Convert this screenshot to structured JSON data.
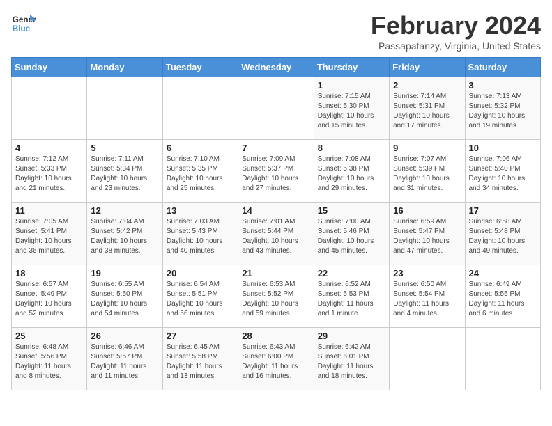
{
  "header": {
    "logo_line1": "General",
    "logo_line2": "Blue",
    "title": "February 2024",
    "subtitle": "Passapatanzy, Virginia, United States"
  },
  "weekdays": [
    "Sunday",
    "Monday",
    "Tuesday",
    "Wednesday",
    "Thursday",
    "Friday",
    "Saturday"
  ],
  "weeks": [
    [
      {
        "day": "",
        "info": ""
      },
      {
        "day": "",
        "info": ""
      },
      {
        "day": "",
        "info": ""
      },
      {
        "day": "",
        "info": ""
      },
      {
        "day": "1",
        "info": "Sunrise: 7:15 AM\nSunset: 5:30 PM\nDaylight: 10 hours\nand 15 minutes."
      },
      {
        "day": "2",
        "info": "Sunrise: 7:14 AM\nSunset: 5:31 PM\nDaylight: 10 hours\nand 17 minutes."
      },
      {
        "day": "3",
        "info": "Sunrise: 7:13 AM\nSunset: 5:32 PM\nDaylight: 10 hours\nand 19 minutes."
      }
    ],
    [
      {
        "day": "4",
        "info": "Sunrise: 7:12 AM\nSunset: 5:33 PM\nDaylight: 10 hours\nand 21 minutes."
      },
      {
        "day": "5",
        "info": "Sunrise: 7:11 AM\nSunset: 5:34 PM\nDaylight: 10 hours\nand 23 minutes."
      },
      {
        "day": "6",
        "info": "Sunrise: 7:10 AM\nSunset: 5:35 PM\nDaylight: 10 hours\nand 25 minutes."
      },
      {
        "day": "7",
        "info": "Sunrise: 7:09 AM\nSunset: 5:37 PM\nDaylight: 10 hours\nand 27 minutes."
      },
      {
        "day": "8",
        "info": "Sunrise: 7:08 AM\nSunset: 5:38 PM\nDaylight: 10 hours\nand 29 minutes."
      },
      {
        "day": "9",
        "info": "Sunrise: 7:07 AM\nSunset: 5:39 PM\nDaylight: 10 hours\nand 31 minutes."
      },
      {
        "day": "10",
        "info": "Sunrise: 7:06 AM\nSunset: 5:40 PM\nDaylight: 10 hours\nand 34 minutes."
      }
    ],
    [
      {
        "day": "11",
        "info": "Sunrise: 7:05 AM\nSunset: 5:41 PM\nDaylight: 10 hours\nand 36 minutes."
      },
      {
        "day": "12",
        "info": "Sunrise: 7:04 AM\nSunset: 5:42 PM\nDaylight: 10 hours\nand 38 minutes."
      },
      {
        "day": "13",
        "info": "Sunrise: 7:03 AM\nSunset: 5:43 PM\nDaylight: 10 hours\nand 40 minutes."
      },
      {
        "day": "14",
        "info": "Sunrise: 7:01 AM\nSunset: 5:44 PM\nDaylight: 10 hours\nand 43 minutes."
      },
      {
        "day": "15",
        "info": "Sunrise: 7:00 AM\nSunset: 5:46 PM\nDaylight: 10 hours\nand 45 minutes."
      },
      {
        "day": "16",
        "info": "Sunrise: 6:59 AM\nSunset: 5:47 PM\nDaylight: 10 hours\nand 47 minutes."
      },
      {
        "day": "17",
        "info": "Sunrise: 6:58 AM\nSunset: 5:48 PM\nDaylight: 10 hours\nand 49 minutes."
      }
    ],
    [
      {
        "day": "18",
        "info": "Sunrise: 6:57 AM\nSunset: 5:49 PM\nDaylight: 10 hours\nand 52 minutes."
      },
      {
        "day": "19",
        "info": "Sunrise: 6:55 AM\nSunset: 5:50 PM\nDaylight: 10 hours\nand 54 minutes."
      },
      {
        "day": "20",
        "info": "Sunrise: 6:54 AM\nSunset: 5:51 PM\nDaylight: 10 hours\nand 56 minutes."
      },
      {
        "day": "21",
        "info": "Sunrise: 6:53 AM\nSunset: 5:52 PM\nDaylight: 10 hours\nand 59 minutes."
      },
      {
        "day": "22",
        "info": "Sunrise: 6:52 AM\nSunset: 5:53 PM\nDaylight: 11 hours\nand 1 minute."
      },
      {
        "day": "23",
        "info": "Sunrise: 6:50 AM\nSunset: 5:54 PM\nDaylight: 11 hours\nand 4 minutes."
      },
      {
        "day": "24",
        "info": "Sunrise: 6:49 AM\nSunset: 5:55 PM\nDaylight: 11 hours\nand 6 minutes."
      }
    ],
    [
      {
        "day": "25",
        "info": "Sunrise: 6:48 AM\nSunset: 5:56 PM\nDaylight: 11 hours\nand 8 minutes."
      },
      {
        "day": "26",
        "info": "Sunrise: 6:46 AM\nSunset: 5:57 PM\nDaylight: 11 hours\nand 11 minutes."
      },
      {
        "day": "27",
        "info": "Sunrise: 6:45 AM\nSunset: 5:58 PM\nDaylight: 11 hours\nand 13 minutes."
      },
      {
        "day": "28",
        "info": "Sunrise: 6:43 AM\nSunset: 6:00 PM\nDaylight: 11 hours\nand 16 minutes."
      },
      {
        "day": "29",
        "info": "Sunrise: 6:42 AM\nSunset: 6:01 PM\nDaylight: 11 hours\nand 18 minutes."
      },
      {
        "day": "",
        "info": ""
      },
      {
        "day": "",
        "info": ""
      }
    ]
  ]
}
